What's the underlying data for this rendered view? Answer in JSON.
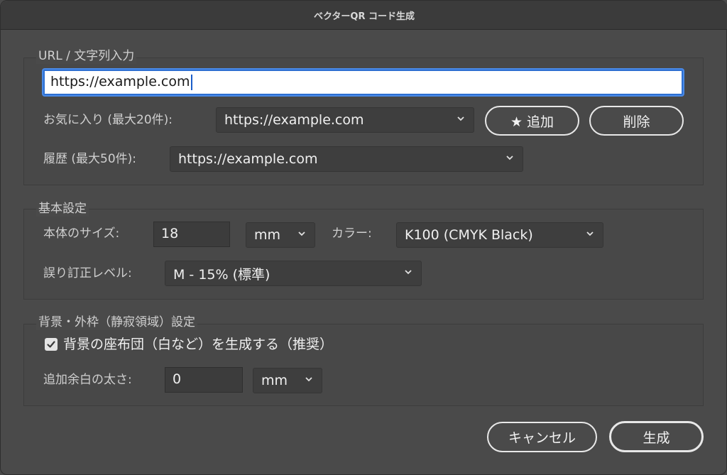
{
  "window": {
    "title": "ベクターQR コード生成"
  },
  "url_section": {
    "legend": "URL / 文字列入力",
    "input_value": "https://example.com",
    "favorites_label": "お気に入り (最大20件):",
    "favorites_selected": "https://example.com",
    "add_button": "★ 追加",
    "delete_button": "削除",
    "history_label": "履歴 (最大50件):",
    "history_selected": "https://example.com"
  },
  "basic_section": {
    "legend": "基本設定",
    "size_label": "本体のサイズ:",
    "size_value": "18",
    "size_unit": "mm",
    "color_label": "カラー:",
    "color_selected": "K100 (CMYK Black)",
    "ecc_label": "誤り訂正レベル:",
    "ecc_selected": "M - 15% (標準)"
  },
  "background_section": {
    "legend": "背景・外枠（静寂領域）設定",
    "checkbox_label": "背景の座布団（白など）を生成する（推奨）",
    "checkbox_checked": true,
    "margin_label": "追加余白の太さ:",
    "margin_value": "0",
    "margin_unit": "mm"
  },
  "footer": {
    "cancel_button": "キャンセル",
    "generate_button": "生成"
  },
  "colors": {
    "background": "#4a4a4a",
    "accent_focus": "#2d6fd1"
  },
  "icons": [
    "chevron-down-icon",
    "checkmark-icon",
    "star-icon"
  ]
}
